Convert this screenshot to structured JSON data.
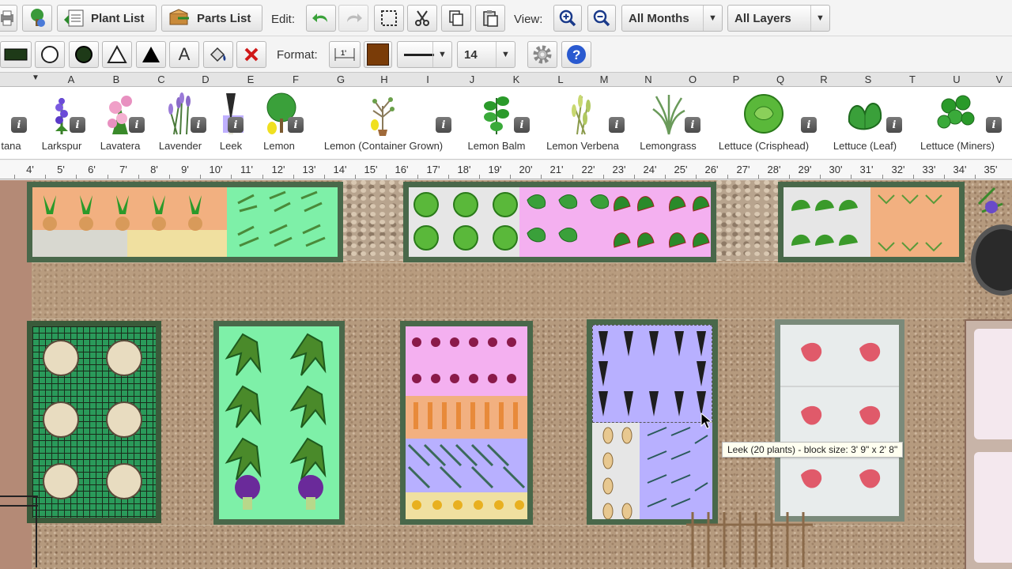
{
  "toolbar1": {
    "plant_list_label": "Plant List",
    "parts_list_label": "Parts List",
    "edit_label": "Edit:",
    "view_label": "View:",
    "months_value": "All Months",
    "layers_value": "All Layers"
  },
  "toolbar2": {
    "format_label": "Format:",
    "font_size_value": "14",
    "fill_color": "#7a3c08"
  },
  "columns": [
    "A",
    "B",
    "C",
    "D",
    "E",
    "F",
    "G",
    "H",
    "I",
    "J",
    "K",
    "L",
    "M",
    "N",
    "O",
    "P",
    "Q",
    "R",
    "S",
    "T",
    "U",
    "V"
  ],
  "plants": [
    {
      "name": "tana"
    },
    {
      "name": "Larkspur"
    },
    {
      "name": "Lavatera"
    },
    {
      "name": "Lavender"
    },
    {
      "name": "Leek"
    },
    {
      "name": "Lemon"
    },
    {
      "name": "Lemon (Container Grown)"
    },
    {
      "name": "Lemon Balm"
    },
    {
      "name": "Lemon Verbena"
    },
    {
      "name": "Lemongrass"
    },
    {
      "name": "Lettuce (Crisphead)"
    },
    {
      "name": "Lettuce (Leaf)"
    },
    {
      "name": "Lettuce (Miners)"
    }
  ],
  "ruler": [
    "4'",
    "5'",
    "6'",
    "7'",
    "8'",
    "9'",
    "10'",
    "11'",
    "12'",
    "13'",
    "14'",
    "15'",
    "16'",
    "17'",
    "18'",
    "19'",
    "20'",
    "21'",
    "22'",
    "23'",
    "24'",
    "25'",
    "26'",
    "27'",
    "28'",
    "29'",
    "30'",
    "31'",
    "32'",
    "33'",
    "34'",
    "35'"
  ],
  "tooltip": "Leek (20 plants) - block size: 3' 9\" x 2' 8\""
}
